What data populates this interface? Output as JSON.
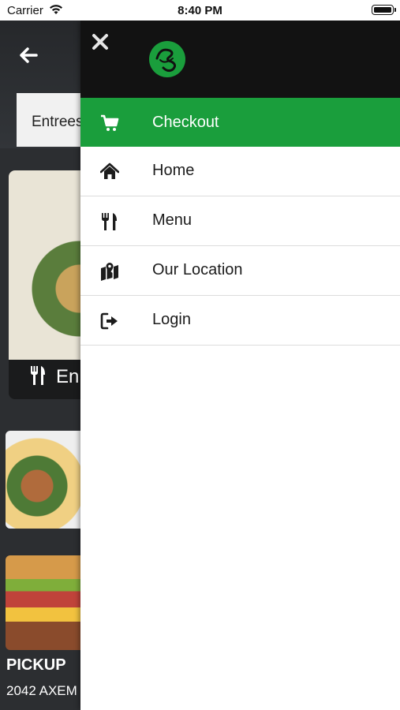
{
  "status_bar": {
    "carrier": "Carrier",
    "time": "8:40 PM"
  },
  "background": {
    "category_tab": "Entrees",
    "card_label": "En",
    "pickup_label": "PICKUP",
    "address": "2042 AXEM"
  },
  "drawer": {
    "logo_icon": "restaurant-logo-icon",
    "close_icon": "close-icon",
    "items": [
      {
        "label": "Checkout",
        "icon": "cart-icon",
        "active": true
      },
      {
        "label": "Home",
        "icon": "home-icon",
        "active": false
      },
      {
        "label": "Menu",
        "icon": "fork-knife-icon",
        "active": false
      },
      {
        "label": "Our Location",
        "icon": "map-icon",
        "active": false
      },
      {
        "label": "Login",
        "icon": "sign-in-icon",
        "active": false
      }
    ]
  },
  "colors": {
    "accent_green": "#1a9e3c",
    "drawer_header": "#121212",
    "background_app": "#2c2e31"
  }
}
